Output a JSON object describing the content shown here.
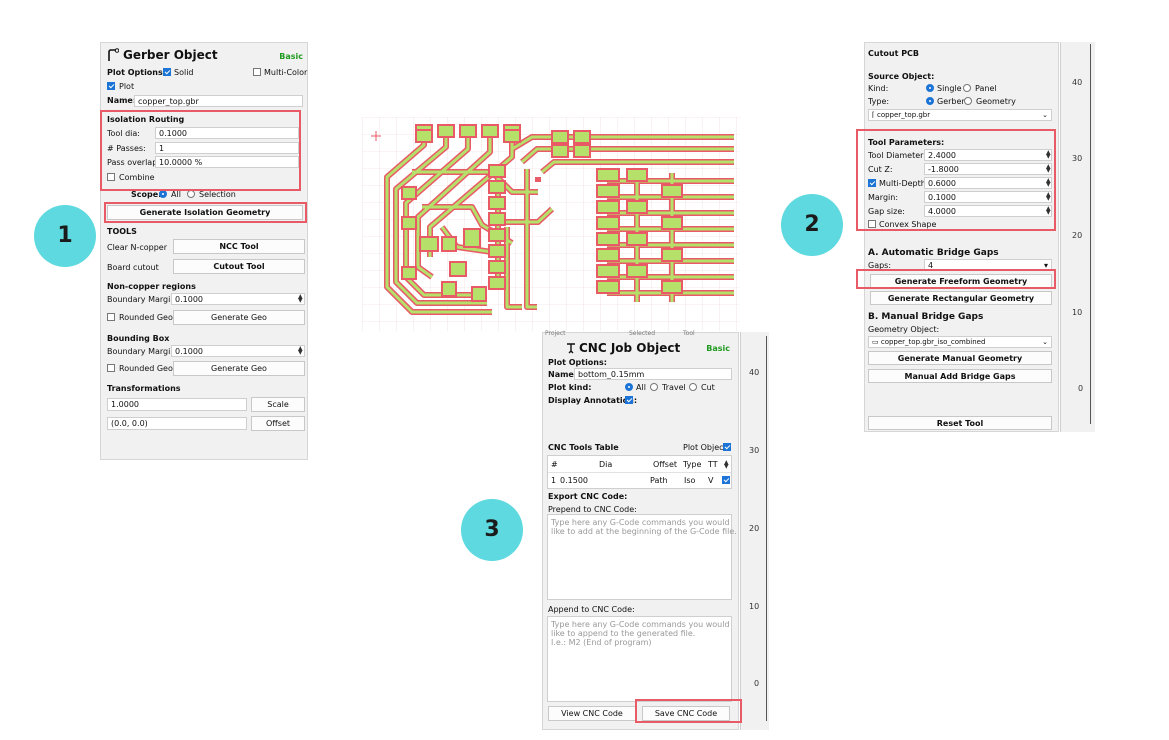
{
  "badges": [
    "1",
    "2",
    "3"
  ],
  "gerber": {
    "title": "Gerber Object",
    "mode": "Basic",
    "plot_options_label": "Plot Options:",
    "solid_label": "Solid",
    "multicolor_label": "Multi-Color",
    "plot_label": "Plot",
    "name_label": "Name:",
    "name_value": "copper_top.gbr",
    "isolation_header": "Isolation Routing",
    "tool_dia_label": "Tool dia:",
    "tool_dia_value": "0.1000",
    "passes_label": "# Passes:",
    "passes_value": "1",
    "overlap_label": "Pass overlap:",
    "overlap_value": "10.0000 %",
    "combine_label": "Combine",
    "scope_label": "Scope:",
    "scope_all": "All",
    "scope_selection": "Selection",
    "gen_iso_button": "Generate Isolation Geometry",
    "tools_header": "TOOLS",
    "clear_ncopper_label": "Clear N-copper",
    "ncc_button": "NCC Tool",
    "board_cutout_label": "Board cutout",
    "cutout_button": "Cutout Tool",
    "noncopper_header": "Non-copper regions",
    "boundary_margin_label": "Boundary Margin:",
    "noncopper_margin_value": "0.1000",
    "rounded_geo_label": "Rounded Geo",
    "generate_geo_button": "Generate Geo",
    "bbox_header": "Bounding Box",
    "bbox_margin_value": "0.1000",
    "bbox_rounded_label": "Rounded Geo",
    "bbox_generate_button": "Generate Geo",
    "transform_header": "Transformations",
    "scale_value": "1.0000",
    "scale_button": "Scale",
    "offset_value": "(0.0, 0.0)",
    "offset_button": "Offset"
  },
  "cutout": {
    "title": "Cutout PCB",
    "source_header": "Source Object:",
    "kind_label": "Kind:",
    "kind_single": "Single",
    "kind_panel": "Panel",
    "type_label": "Type:",
    "type_gerber": "Gerber",
    "type_geometry": "Geometry",
    "source_value": "copper_top.gbr",
    "tool_params_header": "Tool Parameters:",
    "tool_diameter_label": "Tool Diameter:",
    "tool_diameter_value": "2.4000",
    "cutz_label": "Cut Z:",
    "cutz_value": "-1.8000",
    "multidepth_label": "Multi-Depth:",
    "multidepth_value": "0.6000",
    "margin_label": "Margin:",
    "margin_value": "0.1000",
    "gap_size_label": "Gap size:",
    "gap_size_value": "4.0000",
    "convex_label": "Convex Shape",
    "auto_header": "A. Automatic Bridge Gaps",
    "gaps_label": "Gaps:",
    "gaps_value": "4",
    "freeform_button": "Generate Freeform Geometry",
    "rect_button": "Generate Rectangular Geometry",
    "manual_header": "B. Manual Bridge Gaps",
    "geometry_object_label": "Geometry Object:",
    "geometry_object_value": "copper_top.gbr_iso_combined",
    "manual_gen_button": "Generate Manual Geometry",
    "manual_add_button": "Manual Add Bridge Gaps",
    "reset_button": "Reset Tool",
    "ruler_ticks": [
      "40",
      "30",
      "20",
      "10",
      "0"
    ]
  },
  "cnc": {
    "top_tabs": [
      "Project",
      "Selected",
      "Tool"
    ],
    "title": "CNC Job Object",
    "mode": "Basic",
    "plot_options_label": "Plot Options:",
    "name_label": "Name:",
    "name_value": "bottom_0.15mm",
    "plot_kind_label": "Plot kind:",
    "plot_all": "All",
    "plot_travel": "Travel",
    "plot_cut": "Cut",
    "display_annotation_label": "Display Annotation:",
    "tools_table_label": "CNC Tools Table",
    "plot_object_label": "Plot Object",
    "table_headers": [
      "#",
      "Dia",
      "Offset",
      "Type",
      "TT"
    ],
    "table_row": [
      "1",
      "0.1500",
      "Path",
      "Iso",
      "V"
    ],
    "export_header": "Export CNC Code:",
    "prepend_label": "Prepend to CNC Code:",
    "prepend_placeholder": "Type here any G-Code commands you would\nlike to add at the beginning of the G-Code file.",
    "append_label": "Append to CNC Code:",
    "append_placeholder": "Type here any G-Code commands you would\nlike to append to the generated file.\nI.e.: M2 (End of program)",
    "view_button": "View CNC Code",
    "save_button": "Save CNC Code",
    "ruler_ticks": [
      "40",
      "30",
      "20",
      "10",
      "0"
    ]
  },
  "colors": {
    "badge": "#5dd9df",
    "highlight": "#e85a66",
    "accent": "#1b74d6",
    "basic_green": "#1f9a1f",
    "pcb_copper": "#b5e06a",
    "pcb_iso": "#e85a66"
  }
}
